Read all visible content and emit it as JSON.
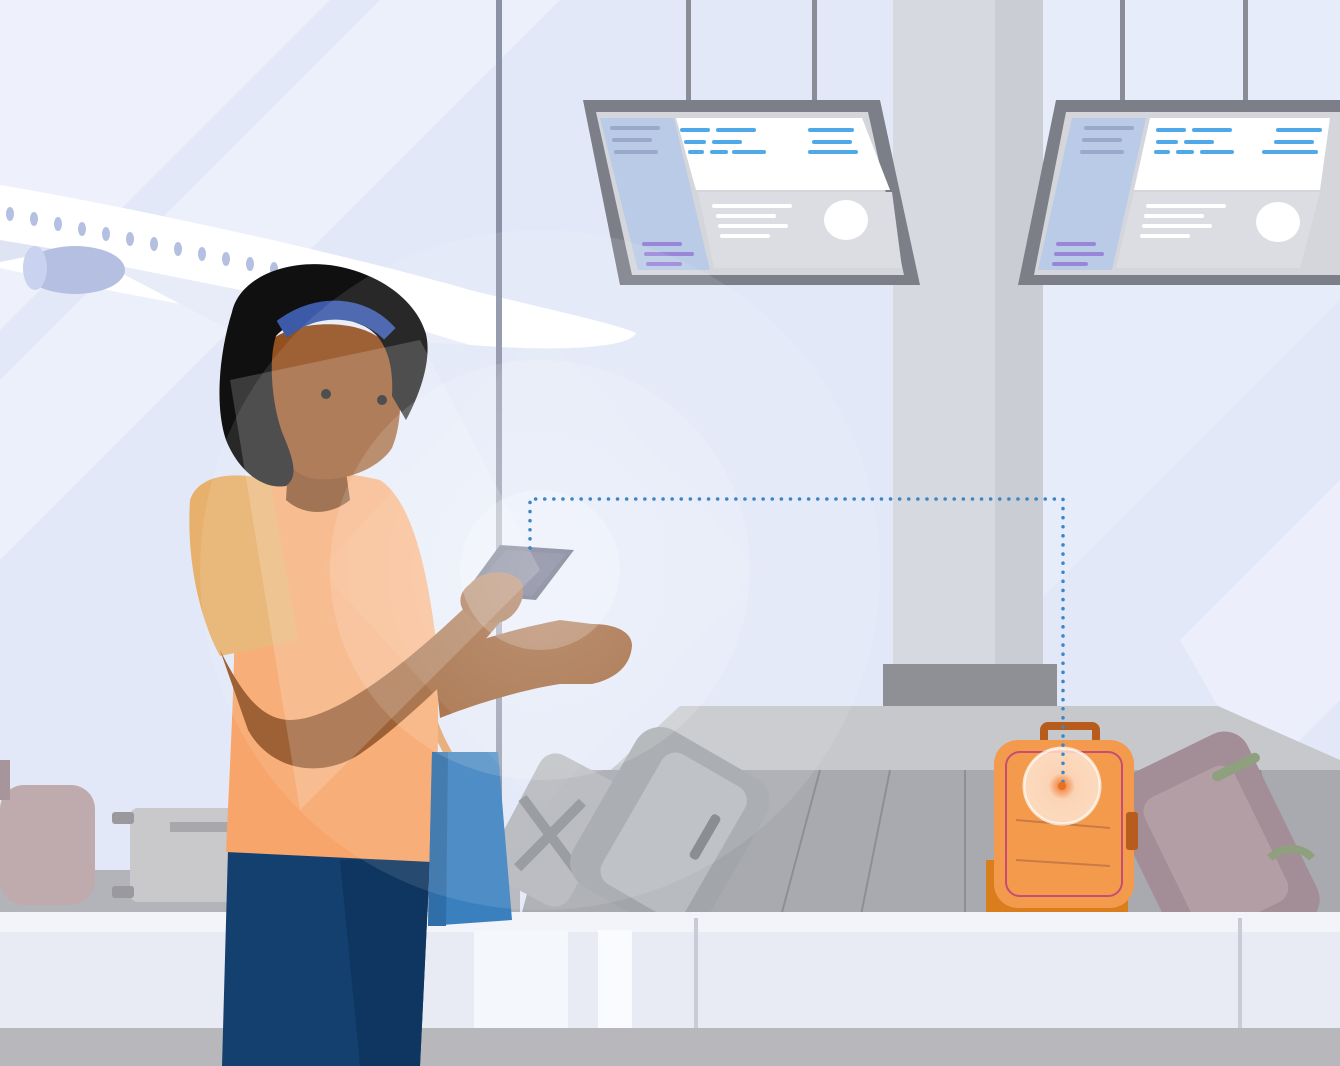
{
  "illustration": {
    "subject": "",
    "palette": {
      "sky": "#e3e8f8",
      "sky_light": "#eef1fb",
      "frame": "#8c92a6",
      "pillar": "#d7d9e0",
      "board_frame": "#7c7f88",
      "board_panel_blue": "#b9cbe6",
      "board_panel_white": "#ffffff",
      "board_text_blue": "#4fa9e8",
      "board_text_purple": "#9a86d8",
      "carousel": "#a9aab0",
      "counter": "#e8ebf3",
      "floor": "#b8b8bc",
      "skin": "#94501f",
      "hair": "#101010",
      "headband": "#3c5aa8",
      "shirt": "#f7a56a",
      "pants": "#13406f",
      "tote": "#3a80bf",
      "suitcase_orange": "#f39a4d",
      "suitcase_purple": "#a38d96",
      "suitcase_grey": "#9ea3a8",
      "signal_dots": "#3b86c6"
    }
  }
}
